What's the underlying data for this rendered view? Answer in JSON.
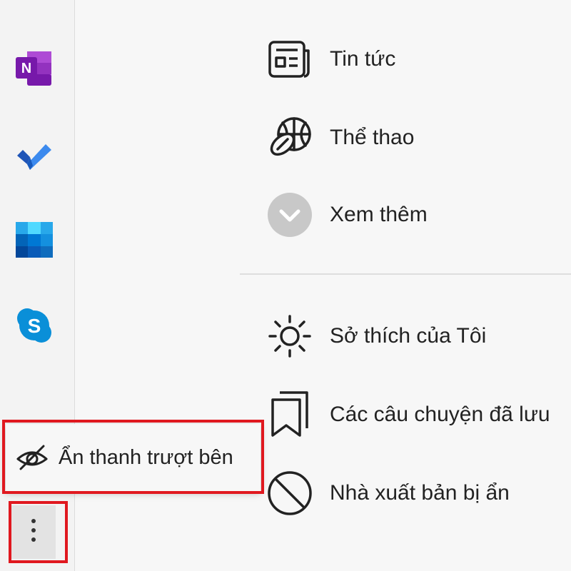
{
  "sidebar": {
    "apps": [
      {
        "icon": "onenote-icon"
      },
      {
        "icon": "todo-icon"
      },
      {
        "icon": "outlook-calendar-icon"
      },
      {
        "icon": "skype-icon"
      }
    ],
    "more_icon": "more-vertical-icon"
  },
  "context_menu": {
    "hide_sidebar_label": "Ẩn thanh trượt bên",
    "hide_sidebar_icon": "eye-off-icon"
  },
  "feed_menu": {
    "news_label": "Tin tức",
    "sports_label": "Thể thao",
    "see_more_label": "Xem thêm",
    "interests_label": "Sở thích của Tôi",
    "saved_stories_label": "Các câu chuyện đã lưu",
    "hidden_publishers_label": "Nhà xuất bản bị ẩn"
  },
  "colors": {
    "highlight_red": "#e0181f",
    "onenote_purple": "#7719aa",
    "todo_blue": "#2564cf",
    "skype_blue": "#0a8fd8"
  }
}
